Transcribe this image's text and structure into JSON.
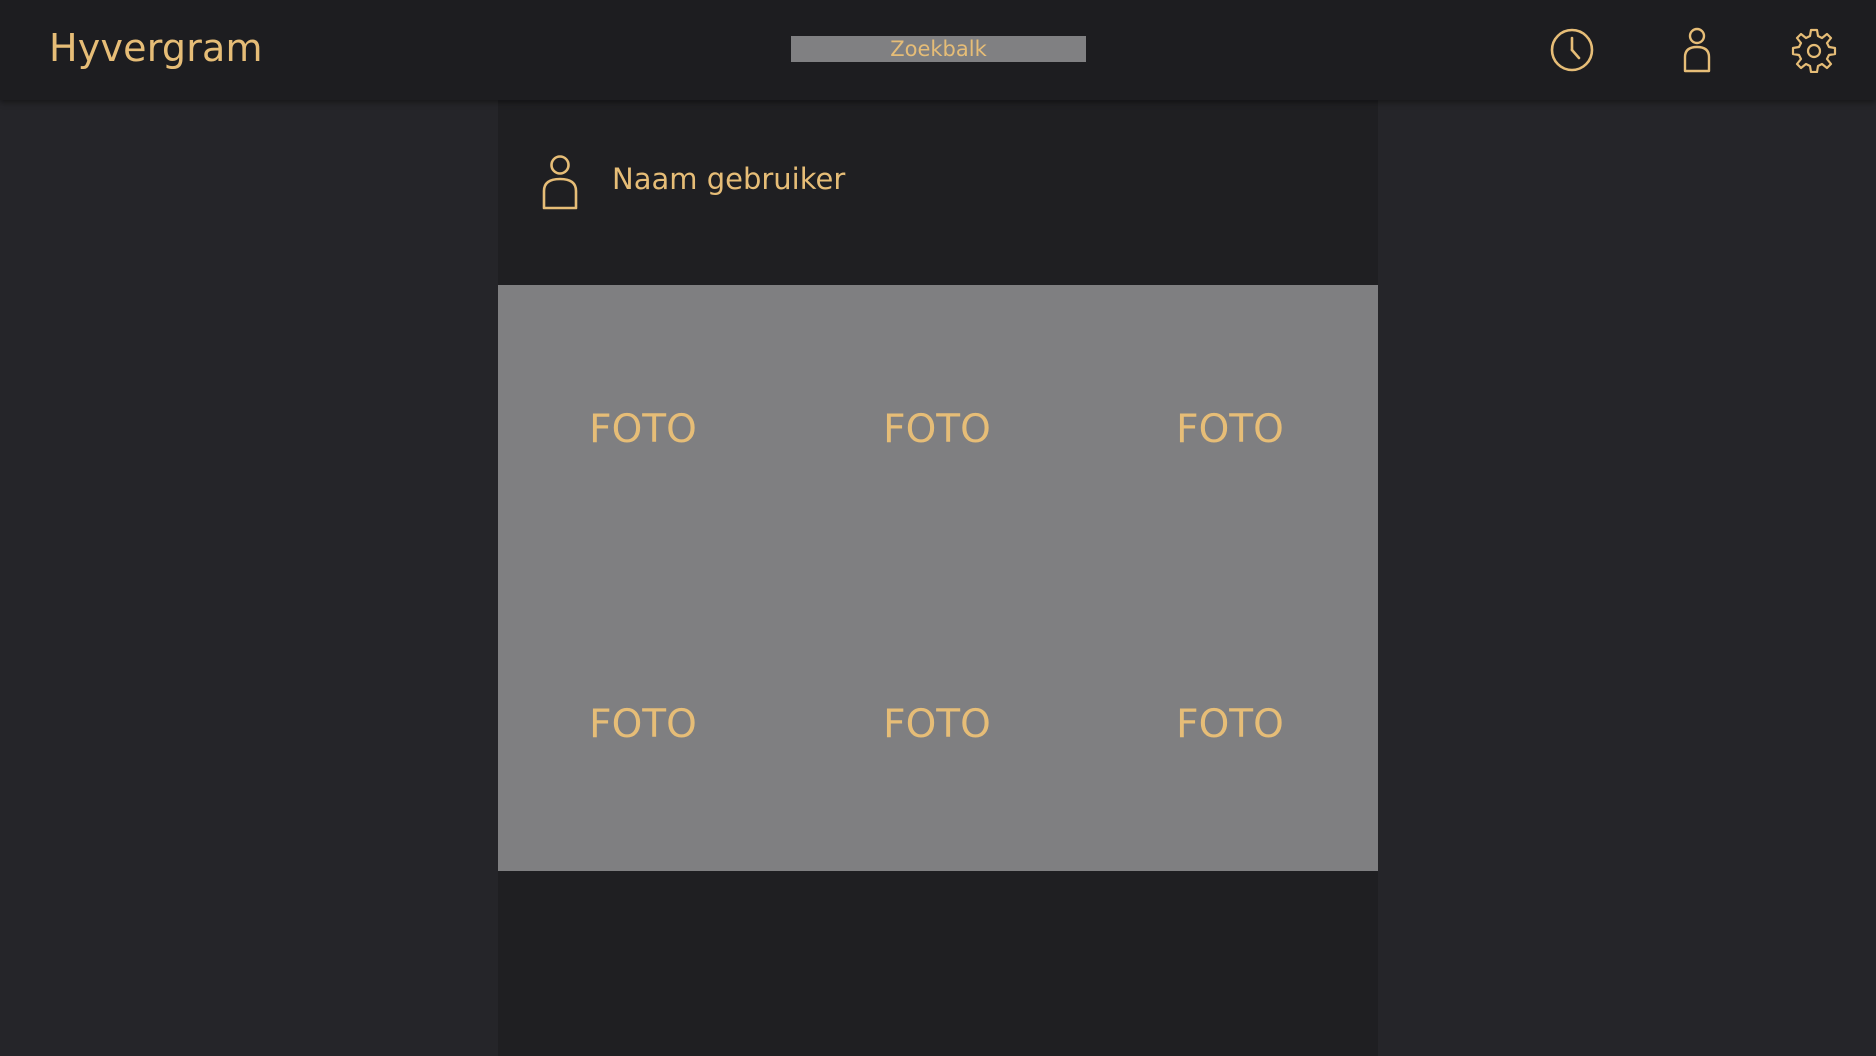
{
  "app": {
    "title": "Hyvergram"
  },
  "search": {
    "placeholder": "Zoekbalk"
  },
  "header_icons": [
    {
      "name": "history-icon"
    },
    {
      "name": "profile-icon"
    },
    {
      "name": "settings-icon"
    }
  ],
  "profile": {
    "username": "Naam gebruiker"
  },
  "photos": [
    {
      "label": "FOTO"
    },
    {
      "label": "FOTO"
    },
    {
      "label": "FOTO"
    },
    {
      "label": "FOTO"
    },
    {
      "label": "FOTO"
    },
    {
      "label": "FOTO"
    }
  ],
  "colors": {
    "accent": "#e6bd77",
    "topbar": "#1d1d20",
    "background": "#242428",
    "photo_area": "#7f7f81"
  }
}
